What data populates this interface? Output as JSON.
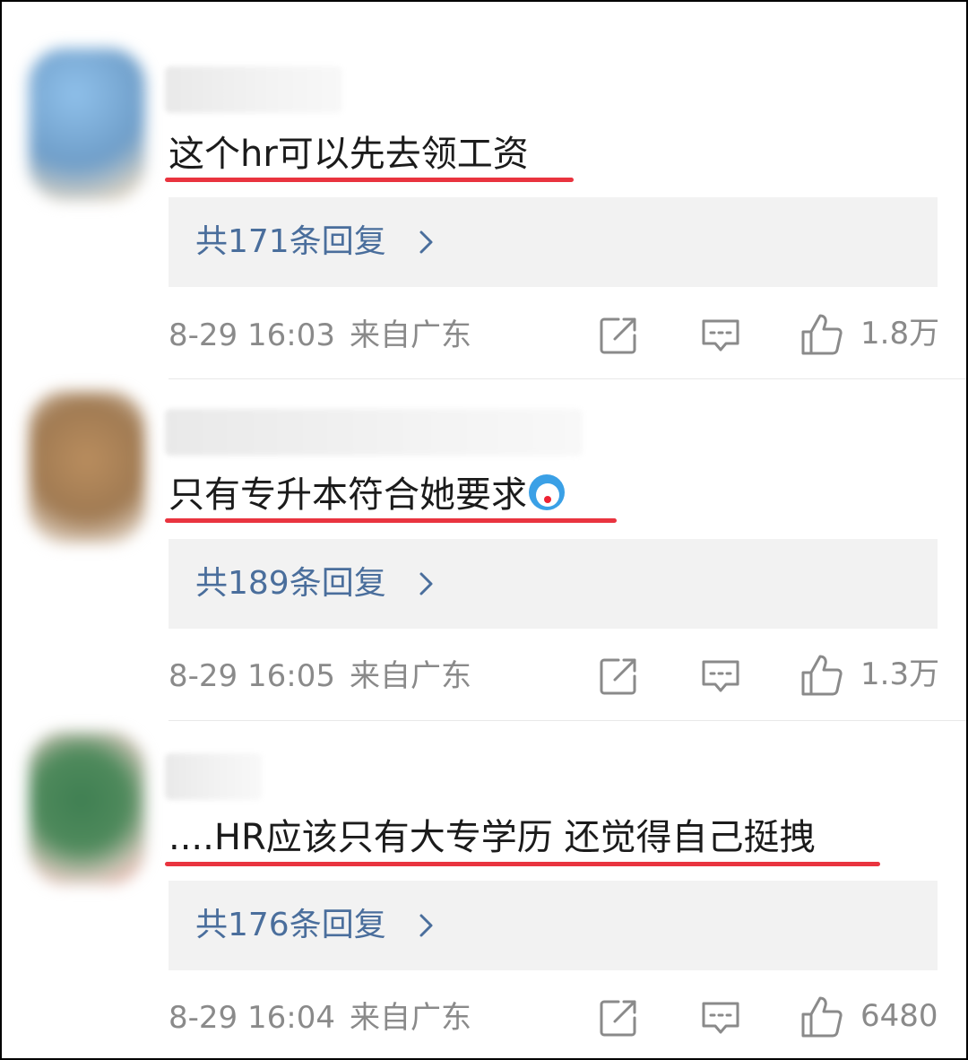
{
  "comments": [
    {
      "text": "这个hr可以先去领工资",
      "replies_label": "共171条回复",
      "timestamp": "8-29 16:03",
      "location": "来自广东",
      "likes": "1.8万",
      "avatar_color": "#6f9ec9"
    },
    {
      "text": "只有专升本符合她要求",
      "has_emoji": true,
      "replies_label": "共189条回复",
      "timestamp": "8-29 16:05",
      "location": "来自广东",
      "likes": "1.3万",
      "avatar_color": "#a07a52"
    },
    {
      "text": "....HR应该只有大专学历 还觉得自己挺拽",
      "replies_label": "共176条回复",
      "timestamp": "8-29 16:04",
      "location": "来自广东",
      "likes": "6480",
      "avatar_color": "#4f8a5c"
    }
  ],
  "colors": {
    "reply_link": "#4a6e9c",
    "underline": "#e9343f",
    "meta_text": "#8a8a8a",
    "reply_box_bg": "#f2f2f2"
  },
  "icons": [
    "share-icon",
    "comment-icon",
    "thumbs-up-icon",
    "chevron-right-icon"
  ]
}
